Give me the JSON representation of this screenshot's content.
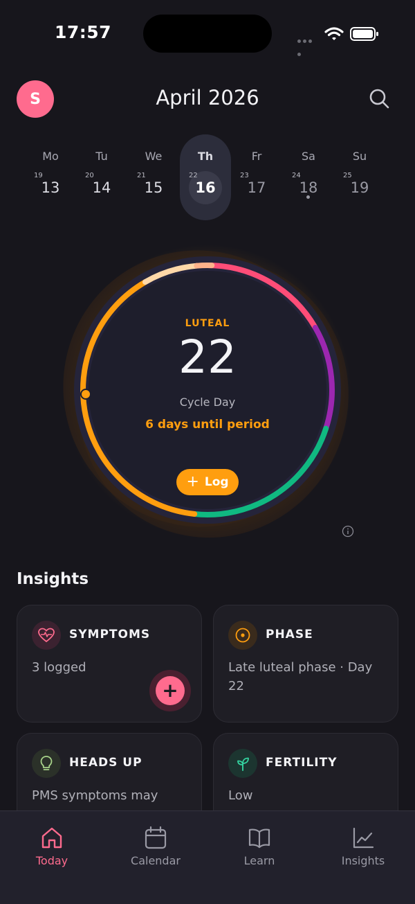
{
  "status_bar": {
    "time": "17:57"
  },
  "header": {
    "avatar_initial": "S",
    "month": "April 2026"
  },
  "week": [
    {
      "name": "Mo",
      "cycle_day": "19",
      "date": "13"
    },
    {
      "name": "Tu",
      "cycle_day": "20",
      "date": "14"
    },
    {
      "name": "We",
      "cycle_day": "21",
      "date": "15"
    },
    {
      "name": "Th",
      "cycle_day": "22",
      "date": "16"
    },
    {
      "name": "Fr",
      "cycle_day": "23",
      "date": "17"
    },
    {
      "name": "Sa",
      "cycle_day": "24",
      "date": "18"
    },
    {
      "name": "Su",
      "cycle_day": "25",
      "date": "19"
    }
  ],
  "cycle": {
    "phase": "LUTEAL",
    "day": "22",
    "day_label": "Cycle Day",
    "countdown": "6 days until period",
    "log_label": "Log",
    "colors": {
      "menstrual": "#ff4d78",
      "follicular": "#9c27b0",
      "ovulation": "#10b981",
      "luteal": "#ff9e0f",
      "late_luteal": "#ffd8a8"
    }
  },
  "insights": {
    "title": "Insights",
    "cards": [
      {
        "title": "SYMPTOMS",
        "body": "3 logged",
        "icon": "heart-pulse-icon",
        "color": "#ff6b8e"
      },
      {
        "title": "PHASE",
        "body": "Late luteal phase · Day 22",
        "icon": "target-icon",
        "color": "#ff9e0f"
      },
      {
        "title": "HEADS UP",
        "body": "PMS symptoms may",
        "icon": "lightbulb-icon",
        "color": "#a8d38a"
      },
      {
        "title": "FERTILITY",
        "body": "Low",
        "icon": "sprout-icon",
        "color": "#34d3a0"
      }
    ]
  },
  "tabs": [
    {
      "label": "Today",
      "icon": "home-icon",
      "active": true
    },
    {
      "label": "Calendar",
      "icon": "calendar-icon",
      "active": false
    },
    {
      "label": "Learn",
      "icon": "book-icon",
      "active": false
    },
    {
      "label": "Insights",
      "icon": "chart-icon",
      "active": false
    }
  ]
}
